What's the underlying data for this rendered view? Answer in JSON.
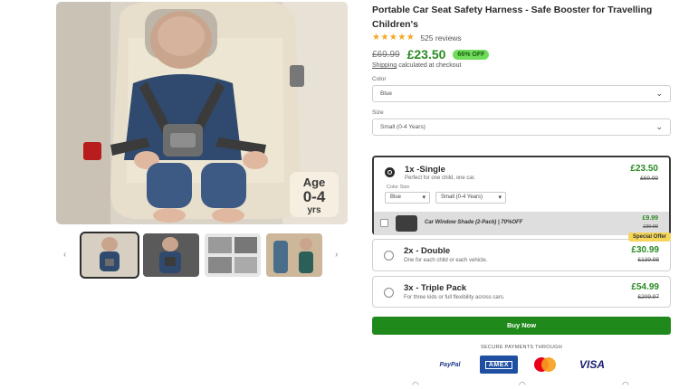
{
  "product": {
    "title": "Portable Car Seat Safety Harness - Safe Booster for Travelling Children's",
    "stars": "★★★★★",
    "reviews": "525 reviews",
    "old_price": "£69.99",
    "price": "£23.50",
    "discount_badge": "66% OFF",
    "shipping_link": "Shipping",
    "shipping_text": "calculated at checkout"
  },
  "gallery": {
    "age_badge": {
      "line1": "Age",
      "line2": "0-4",
      "line3": "yrs"
    },
    "prev_arrow": "‹",
    "next_arrow": "›"
  },
  "options": {
    "color_label": "Color",
    "color_value": "Blue",
    "size_label": "Size",
    "size_value": "Small (0-4 Years)"
  },
  "bundles": [
    {
      "title": "1x -Single",
      "subtitle": "Perfect for one child, one car.",
      "price": "£23.50",
      "old_price": "£69.99",
      "selected": true,
      "mini_label": "Color Size",
      "mini_color": "Blue",
      "mini_size": "Small (0-4 Years)",
      "addon": {
        "title": "Car Window Shade (2-Pack) | 70%OFF",
        "price": "£9.99",
        "old_price": "£39.99"
      }
    },
    {
      "title": "2x - Double",
      "subtitle": "One for each child or each vehicle.",
      "price": "£30.99",
      "old_price": "£139.98",
      "badge": "Special Offer",
      "selected": false
    },
    {
      "title": "3x - Triple Pack",
      "subtitle": "For three kids or full flexibility across cars.",
      "price": "£54.99",
      "old_price": "£209.97",
      "selected": false
    }
  ],
  "buy_button": "Buy Now",
  "secure_text": "SECURE PAYMENTS THROUGH",
  "payments": {
    "paypal": "PayPal",
    "amex": "AMEX",
    "visa": "VISA"
  },
  "colors": {
    "accent_green": "#1f8a1b",
    "price_green": "#2b8a24",
    "badge_green": "#6fdc5c",
    "special_yellow": "#f5d65a"
  }
}
